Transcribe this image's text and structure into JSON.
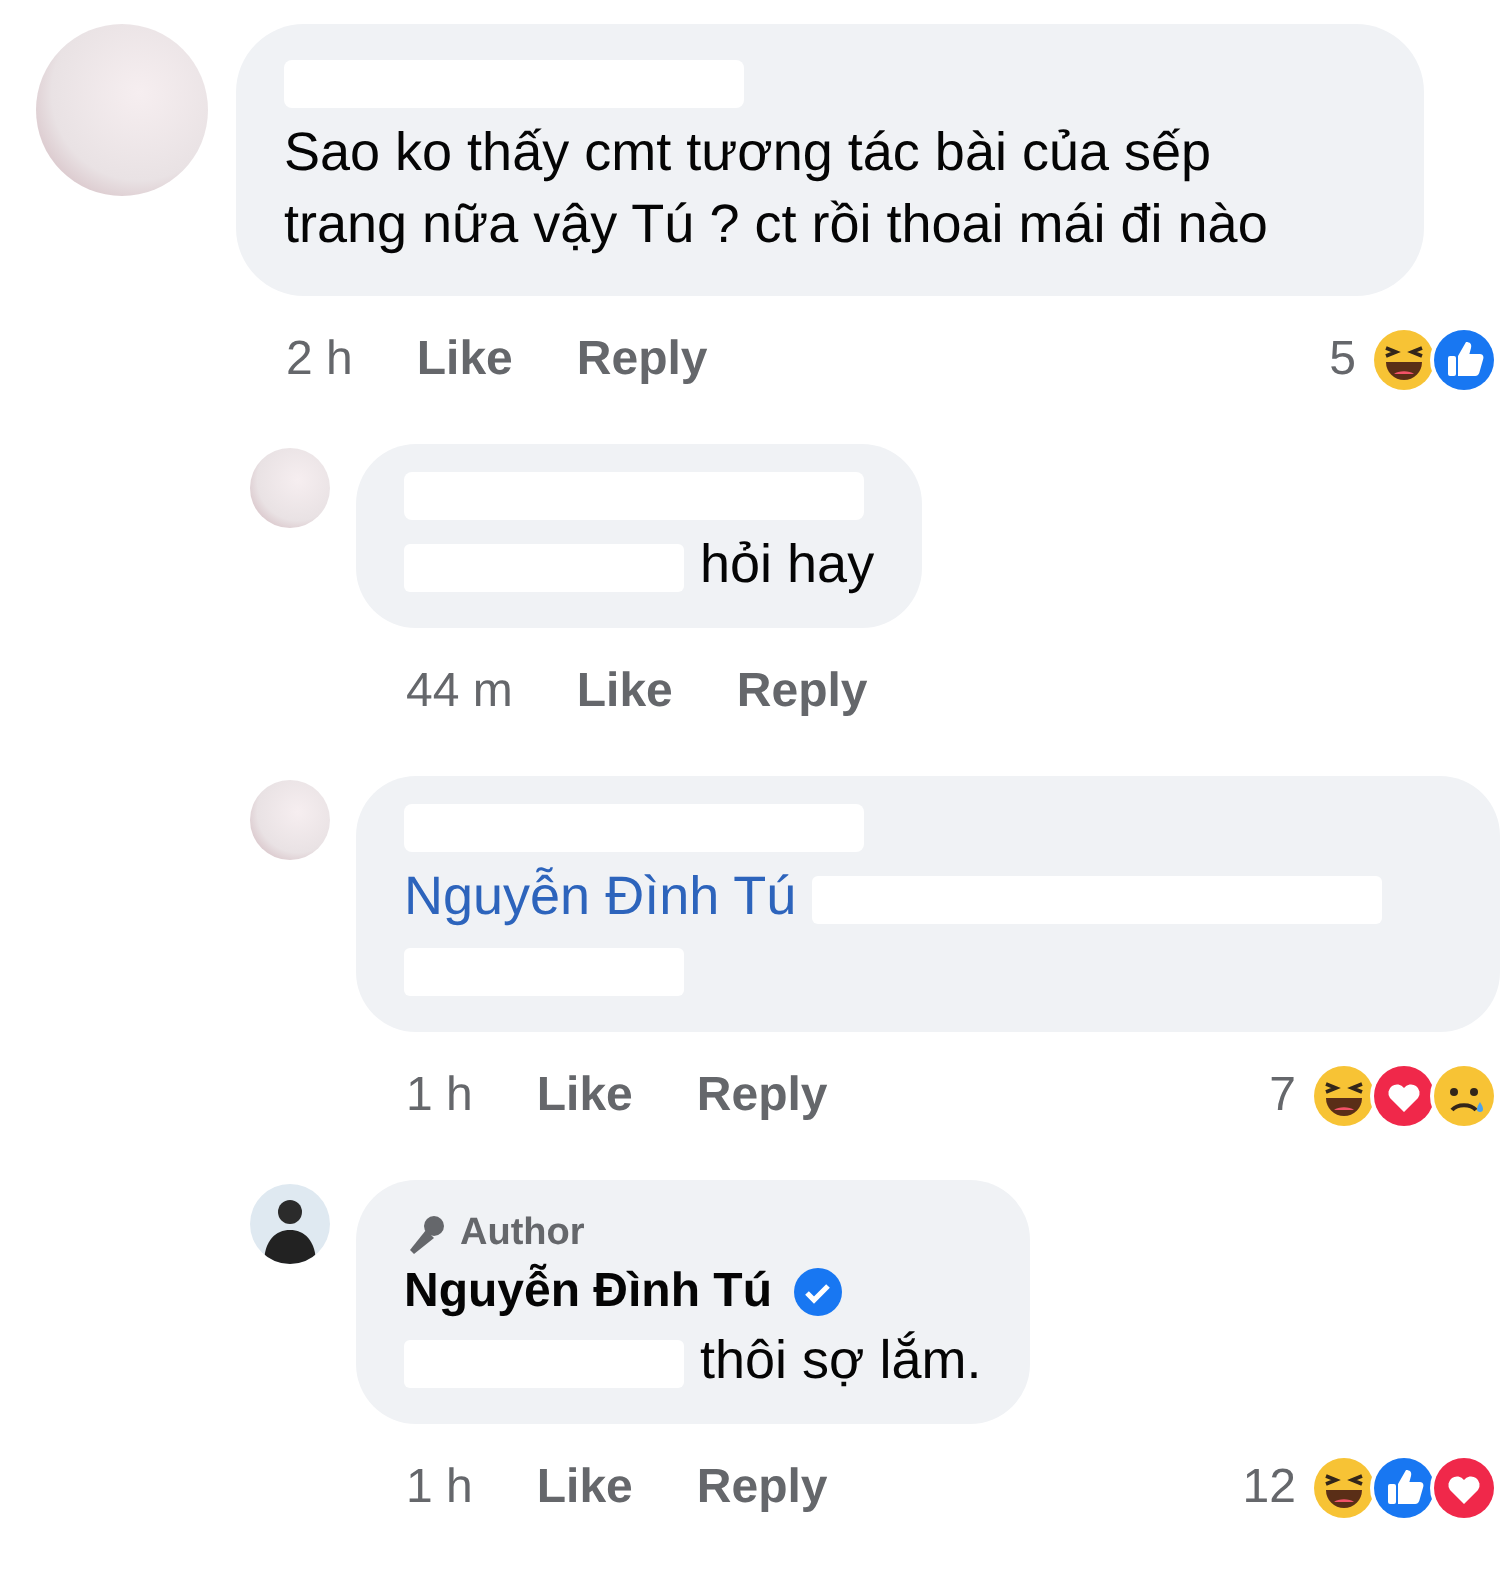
{
  "comments": [
    {
      "avatar": {
        "kind": "blurred"
      },
      "name_redacted": true,
      "parts": [
        {
          "kind": "text",
          "text": "Sao ko thấy cmt tương tác bài của sếp trang nữa vậy Tú ? ct rồi thoai mái đi nào"
        }
      ],
      "time": "2 h",
      "actions": [
        "Like",
        "Reply"
      ],
      "reaction_count": "5",
      "reactions": [
        {
          "kind": "haha"
        },
        {
          "kind": "like"
        }
      ],
      "children": [
        {
          "avatar": {
            "kind": "blurred"
          },
          "name_redacted": true,
          "parts": [
            {
              "kind": "redacted"
            },
            {
              "kind": "text",
              "text": "hỏi hay"
            }
          ],
          "time": "44 m",
          "actions": [
            "Like",
            "Reply"
          ]
        },
        {
          "avatar": {
            "kind": "blurred"
          },
          "name_redacted": true,
          "parts": [
            {
              "kind": "mention",
              "text": "Nguyễn Đình Tú"
            },
            {
              "kind": "redacted_long"
            },
            {
              "kind": "redacted"
            }
          ],
          "time": "1 h",
          "actions": [
            "Like",
            "Reply"
          ],
          "reaction_count": "7",
          "reactions": [
            {
              "kind": "haha"
            },
            {
              "kind": "love"
            },
            {
              "kind": "sad"
            }
          ]
        },
        {
          "avatar": {
            "kind": "person"
          },
          "badge": "Author",
          "name": "Nguyễn Đình Tú",
          "verified": true,
          "parts": [
            {
              "kind": "redacted"
            },
            {
              "kind": "text",
              "text": "thôi sợ lắm."
            }
          ],
          "time": "1 h",
          "actions": [
            "Like",
            "Reply"
          ],
          "reaction_count": "12",
          "reactions": [
            {
              "kind": "haha"
            },
            {
              "kind": "like"
            },
            {
              "kind": "love"
            }
          ]
        }
      ]
    }
  ]
}
